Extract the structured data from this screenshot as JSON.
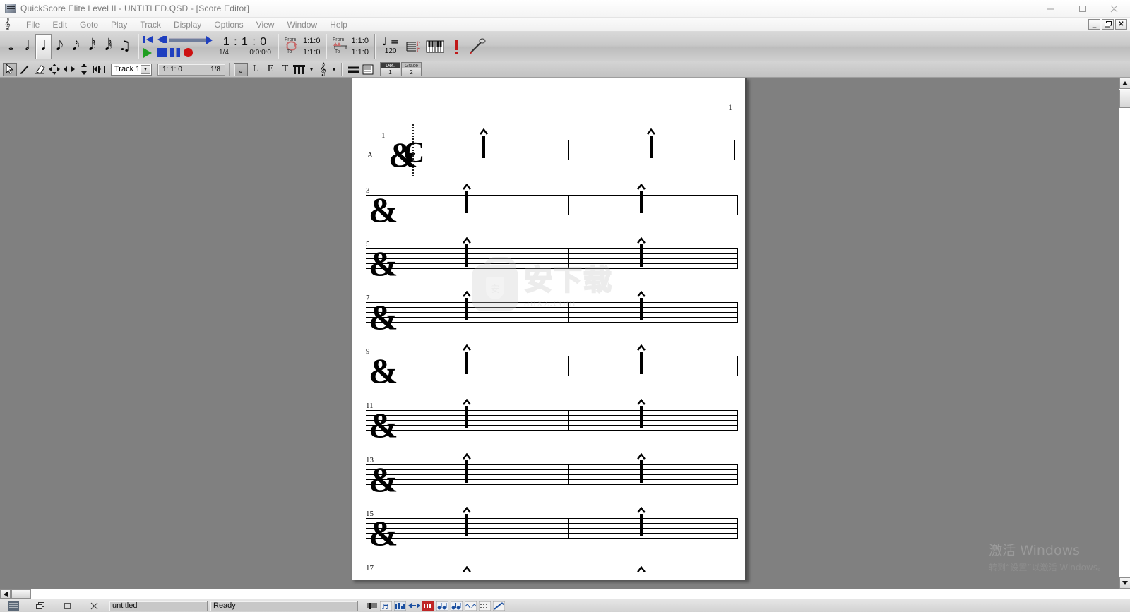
{
  "window": {
    "title": "QuickScore Elite Level II  -  UNTITLED.QSD - [Score Editor]",
    "minimize": "–",
    "maximize": "□",
    "close": "✕"
  },
  "mdi_controls": {
    "minimize": "_",
    "restore": "❐",
    "close": "✕"
  },
  "menu": {
    "doc_icon": "score-clef-icon",
    "items": [
      {
        "label": "File"
      },
      {
        "label": "Edit"
      },
      {
        "label": "Goto"
      },
      {
        "label": "Play"
      },
      {
        "label": "Track"
      },
      {
        "label": "Display"
      },
      {
        "label": "Options"
      },
      {
        "label": "View"
      },
      {
        "label": "Window"
      },
      {
        "label": "Help"
      }
    ]
  },
  "toolbar1": {
    "durations": [
      {
        "name": "whole-note",
        "glyph": "𝅝",
        "selected": false
      },
      {
        "name": "half-note",
        "glyph": "𝅗𝅥",
        "selected": false
      },
      {
        "name": "quarter-note",
        "glyph": "𝅘𝅥",
        "selected": true
      },
      {
        "name": "eighth-note",
        "glyph": "𝅘𝅥𝅮",
        "selected": false
      },
      {
        "name": "sixteenth-note",
        "glyph": "𝅘𝅥𝅯",
        "selected": false
      },
      {
        "name": "thirtysecond-note",
        "glyph": "𝅘𝅥𝅰",
        "selected": false
      },
      {
        "name": "sixtyfourth-note",
        "glyph": "𝅘𝅥𝅱",
        "selected": false
      },
      {
        "name": "beamed-notes",
        "glyph": "♫",
        "selected": false
      }
    ],
    "transport": {
      "rewind": "rewind-to-start-button",
      "step_back": "step-back-button",
      "play": "play-button",
      "stop": "stop-button",
      "pause": "pause-button",
      "record": "record-button"
    },
    "position": {
      "main": "1 : 1 : 0",
      "resolution": "1/4",
      "smpte": "0:0:0:0"
    },
    "loop": {
      "from_label": "From",
      "to_label": "To",
      "from_value": "1:1:0",
      "to_value": "1:1:0"
    },
    "punch": {
      "from_label": "From",
      "to_label": "To",
      "from_value": "1:1:0",
      "to_value": "1:1:0"
    },
    "tempo": {
      "note": "♩ =",
      "value": "120"
    },
    "extra_buttons": [
      {
        "name": "notation-view-button",
        "glyph": "𝄞"
      },
      {
        "name": "piano-keyboard-button",
        "glyph": "🎹"
      },
      {
        "name": "metronome-button",
        "glyph": "❙"
      },
      {
        "name": "microphone-button",
        "glyph": "🎤"
      }
    ]
  },
  "toolbar2": {
    "tools": [
      {
        "name": "select-arrow-tool",
        "glyph": "➤",
        "selected": true
      },
      {
        "name": "pencil-tool",
        "glyph": "✎",
        "selected": false
      },
      {
        "name": "eraser-tool",
        "glyph": "▱",
        "selected": false
      },
      {
        "name": "move-tool",
        "glyph": "✥",
        "selected": false
      },
      {
        "name": "horizontal-move-tool",
        "glyph": "↔",
        "selected": false
      },
      {
        "name": "vertical-move-tool",
        "glyph": "↕",
        "selected": false
      },
      {
        "name": "split-note-tool",
        "glyph": "⧸",
        "selected": false
      }
    ],
    "track_select": {
      "value": "Track 1",
      "arrow": "▼"
    },
    "position_field": {
      "location": "1: 1: 0",
      "resolution": "1/8"
    },
    "notation_buttons": [
      {
        "name": "note-duration-button",
        "glyph": "𝅗𝅥",
        "selected": true
      },
      {
        "name": "lyric-tool-button",
        "glyph": "L",
        "selected": false
      },
      {
        "name": "expression-tool-button",
        "glyph": "E",
        "selected": false
      },
      {
        "name": "text-tool-button",
        "glyph": "T",
        "selected": false
      },
      {
        "name": "beam-tool-button",
        "glyph": "ⅡⅡ",
        "selected": false
      },
      {
        "name": "clef-tool-button",
        "glyph": "𝄞",
        "selected": false
      }
    ],
    "dropdown_arrow": "▾",
    "view_buttons": [
      {
        "name": "staff-view-button",
        "glyph": "☰"
      },
      {
        "name": "list-view-button",
        "glyph": "☷"
      }
    ],
    "def_grace": [
      {
        "name": "default-voice-button",
        "top": "Def.",
        "bottom": "1",
        "active": true
      },
      {
        "name": "grace-voice-button",
        "top": "Grace",
        "bottom": "2",
        "active": false
      }
    ]
  },
  "score": {
    "page_number": "1",
    "track_label": "A",
    "clef_glyph": "&",
    "time_signature": "C",
    "systems": [
      {
        "measure_number": "1",
        "first_system": true
      },
      {
        "measure_number": "3",
        "first_system": false
      },
      {
        "measure_number": "5",
        "first_system": false
      },
      {
        "measure_number": "7",
        "first_system": false
      },
      {
        "measure_number": "9",
        "first_system": false
      },
      {
        "measure_number": "11",
        "first_system": false
      },
      {
        "measure_number": "13",
        "first_system": false
      },
      {
        "measure_number": "15",
        "first_system": false
      },
      {
        "measure_number": "17",
        "first_system": false
      }
    ]
  },
  "watermark": {
    "chinese": "安下载",
    "url": "anxz.com",
    "badge_glyph": "安"
  },
  "activation": {
    "line1": "激活 Windows",
    "line2": "转到“设置”以激活 Windows。"
  },
  "statusbar": {
    "document_name": "untitled",
    "message": "Ready",
    "task_icons": [
      {
        "name": "app-icon",
        "glyph": "♫"
      },
      {
        "name": "restore-window-icon",
        "glyph": "❐"
      },
      {
        "name": "maximize-window-icon",
        "glyph": "□"
      },
      {
        "name": "close-window-icon",
        "glyph": "✕"
      }
    ],
    "view_icons": [
      {
        "name": "score-editor-icon",
        "glyph": "☰"
      },
      {
        "name": "notation-window-icon",
        "glyph": "♬"
      },
      {
        "name": "mixer-window-icon",
        "glyph": "▤"
      },
      {
        "name": "event-list-icon",
        "glyph": "↔"
      },
      {
        "name": "tempo-map-icon",
        "glyph": "▣"
      },
      {
        "name": "piano-roll-icon",
        "glyph": "♪"
      },
      {
        "name": "drum-editor-icon",
        "glyph": "♭"
      },
      {
        "name": "audio-window-icon",
        "glyph": "≋"
      },
      {
        "name": "controller-window-icon",
        "glyph": "∷"
      },
      {
        "name": "library-window-icon",
        "glyph": "✒"
      }
    ]
  },
  "scrollbars": {
    "v_up": "▲",
    "v_down": "▼",
    "h_left": "◄",
    "h_right": "►"
  }
}
